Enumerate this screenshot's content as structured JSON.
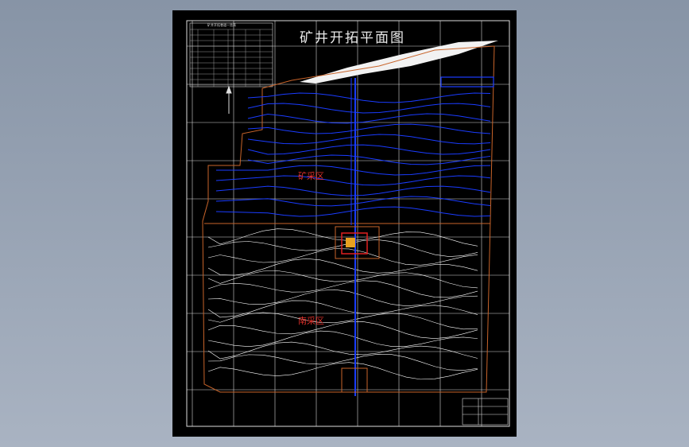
{
  "drawing": {
    "title": "矿井开拓平面图",
    "upper_zone_label": "矿采区",
    "lower_zone_label": "南采区",
    "legend_title": "矿井开拓巷道一览表"
  },
  "colors": {
    "background": "#000000",
    "grid": "#e6e6e6",
    "contour": "#ffffff",
    "workings": "#1a3cff",
    "boundary": "#c8642a",
    "shaft": "#e02020"
  }
}
